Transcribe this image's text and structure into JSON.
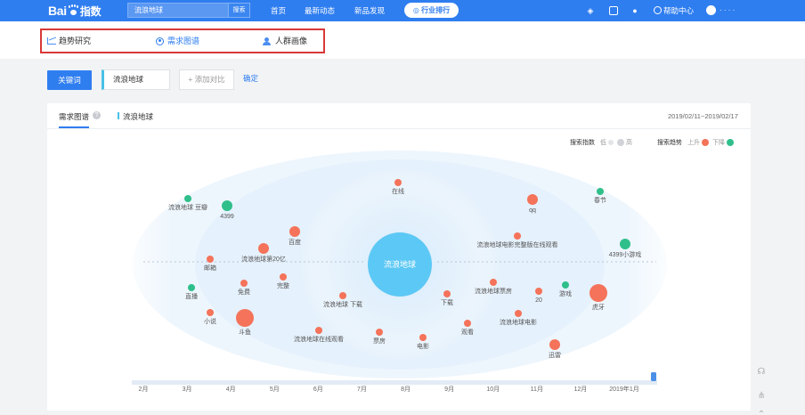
{
  "header": {
    "logo_text": "Bai",
    "logo_suffix": "指数",
    "search_value": "流浪地球",
    "search_button": "搜索",
    "nav": [
      "首页",
      "最新动态",
      "新品发现"
    ],
    "rank_button": "行业排行",
    "help_label": "帮助中心",
    "user_name": "·  · · ·"
  },
  "sub_tabs": [
    {
      "label": "趋势研究",
      "active": false,
      "icon": "trend-chart-icon"
    },
    {
      "label": "需求图谱",
      "active": true,
      "icon": "radio-dot-icon"
    },
    {
      "label": "人群画像",
      "active": false,
      "icon": "person-icon"
    }
  ],
  "keyword_bar": {
    "keyword_button": "关键词",
    "keyword_value": "流浪地球",
    "add_compare": "+ 添加对比",
    "confirm": "确定"
  },
  "panel": {
    "tab_label": "需求图谱",
    "keyword_label": "流浪地球",
    "date_range": "2019/02/11~2019/02/17",
    "legend": {
      "index_label": "搜索指数",
      "low": "低",
      "high": "高",
      "trend_label": "搜索趋势",
      "up": "上升",
      "down": "下降"
    }
  },
  "colors": {
    "primary": "#2f7ef0",
    "rising": "#f4735a",
    "falling": "#2fbf8a",
    "center": "#5cc8f5",
    "highlight_box": "#d93838"
  },
  "chart_data": {
    "type": "scatter",
    "center_term": "流浪地球",
    "timeline": [
      "2月",
      "3月",
      "4月",
      "5月",
      "6月",
      "7月",
      "8月",
      "9月",
      "10月",
      "11月",
      "12月",
      "2019年1月"
    ],
    "terms": [
      {
        "label": "在线",
        "trend": "up",
        "size": "small"
      },
      {
        "label": "流浪地球 豆瓣",
        "trend": "down",
        "size": "small"
      },
      {
        "label": "4399",
        "trend": "down",
        "size": "medium"
      },
      {
        "label": "百度",
        "trend": "up",
        "size": "medium"
      },
      {
        "label": "流浪地球第20亿",
        "trend": "up",
        "size": "medium"
      },
      {
        "label": "邮箱",
        "trend": "up",
        "size": "small"
      },
      {
        "label": "免费",
        "trend": "up",
        "size": "small"
      },
      {
        "label": "完整",
        "trend": "up",
        "size": "small"
      },
      {
        "label": "直播",
        "trend": "down",
        "size": "small"
      },
      {
        "label": "流浪地球 下载",
        "trend": "up",
        "size": "small"
      },
      {
        "label": "小说",
        "trend": "up",
        "size": "small"
      },
      {
        "label": "斗鱼",
        "trend": "up",
        "size": "large"
      },
      {
        "label": "流浪地球在线观看",
        "trend": "up",
        "size": "small"
      },
      {
        "label": "票房",
        "trend": "up",
        "size": "small"
      },
      {
        "label": "电影",
        "trend": "up",
        "size": "small"
      },
      {
        "label": "qq",
        "trend": "up",
        "size": "medium"
      },
      {
        "label": "春节",
        "trend": "down",
        "size": "small"
      },
      {
        "label": "流浪地球电影完整版在线观看",
        "trend": "up",
        "size": "small"
      },
      {
        "label": "4399小游戏",
        "trend": "down",
        "size": "medium"
      },
      {
        "label": "下载",
        "trend": "up",
        "size": "small"
      },
      {
        "label": "流浪地球票房",
        "trend": "up",
        "size": "small"
      },
      {
        "label": "20",
        "trend": "up",
        "size": "small"
      },
      {
        "label": "游戏",
        "trend": "down",
        "size": "small"
      },
      {
        "label": "虎牙",
        "trend": "up",
        "size": "large"
      },
      {
        "label": "观看",
        "trend": "up",
        "size": "small"
      },
      {
        "label": "流浪地球电影",
        "trend": "up",
        "size": "small"
      },
      {
        "label": "迅雷",
        "trend": "up",
        "size": "medium"
      }
    ]
  }
}
